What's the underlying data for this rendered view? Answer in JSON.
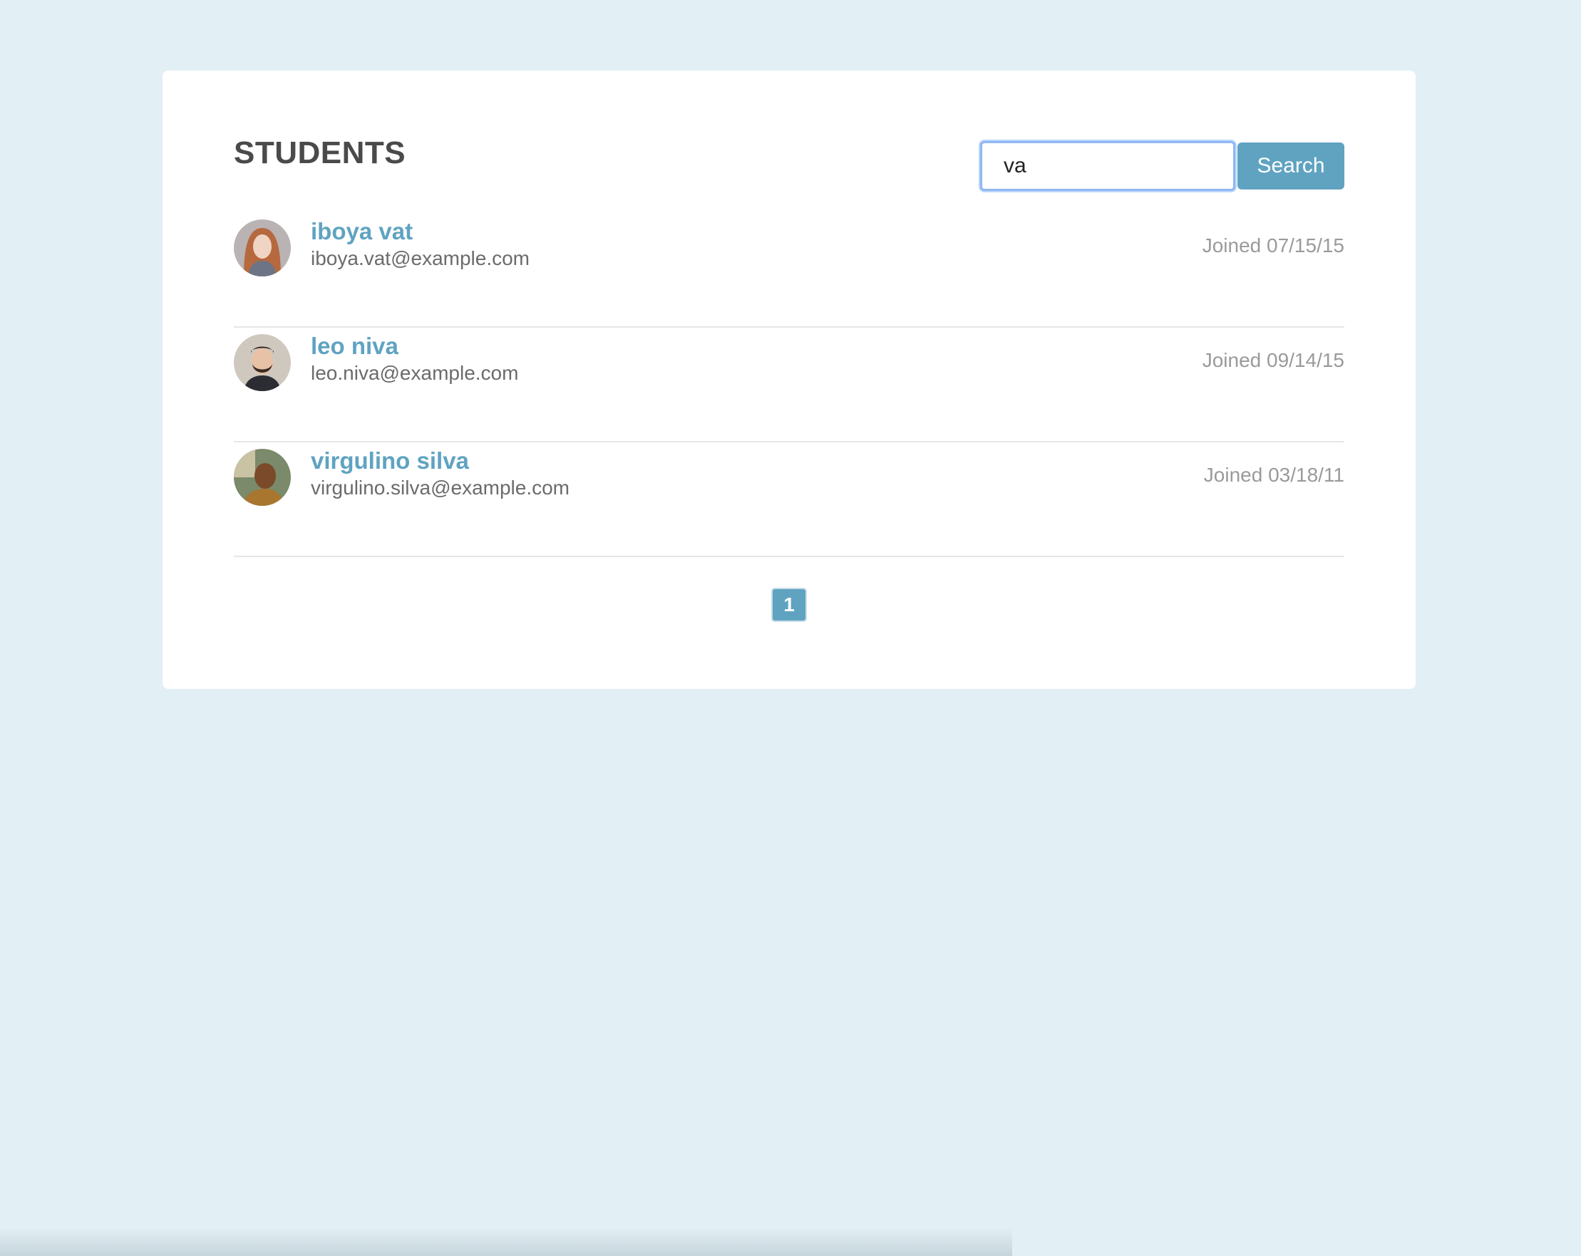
{
  "page": {
    "title": "STUDENTS"
  },
  "search": {
    "value": "va",
    "button_label": "Search"
  },
  "students": [
    {
      "name": "iboya vat",
      "email": "iboya.vat@example.com",
      "joined": "Joined 07/15/15",
      "avatar_icon": "avatar-woman-red-hair"
    },
    {
      "name": "leo niva",
      "email": "leo.niva@example.com",
      "joined": "Joined 09/14/15",
      "avatar_icon": "avatar-man-beard"
    },
    {
      "name": "virgulino silva",
      "email": "virgulino.silva@example.com",
      "joined": "Joined 03/18/11",
      "avatar_icon": "avatar-man-dark-skin"
    }
  ],
  "pagination": {
    "pages": [
      "1"
    ],
    "current": "1"
  },
  "colors": {
    "background": "#e2eff5",
    "accent": "#5fa3c1",
    "title": "#4a4a4a",
    "muted": "#9a9a9a"
  }
}
